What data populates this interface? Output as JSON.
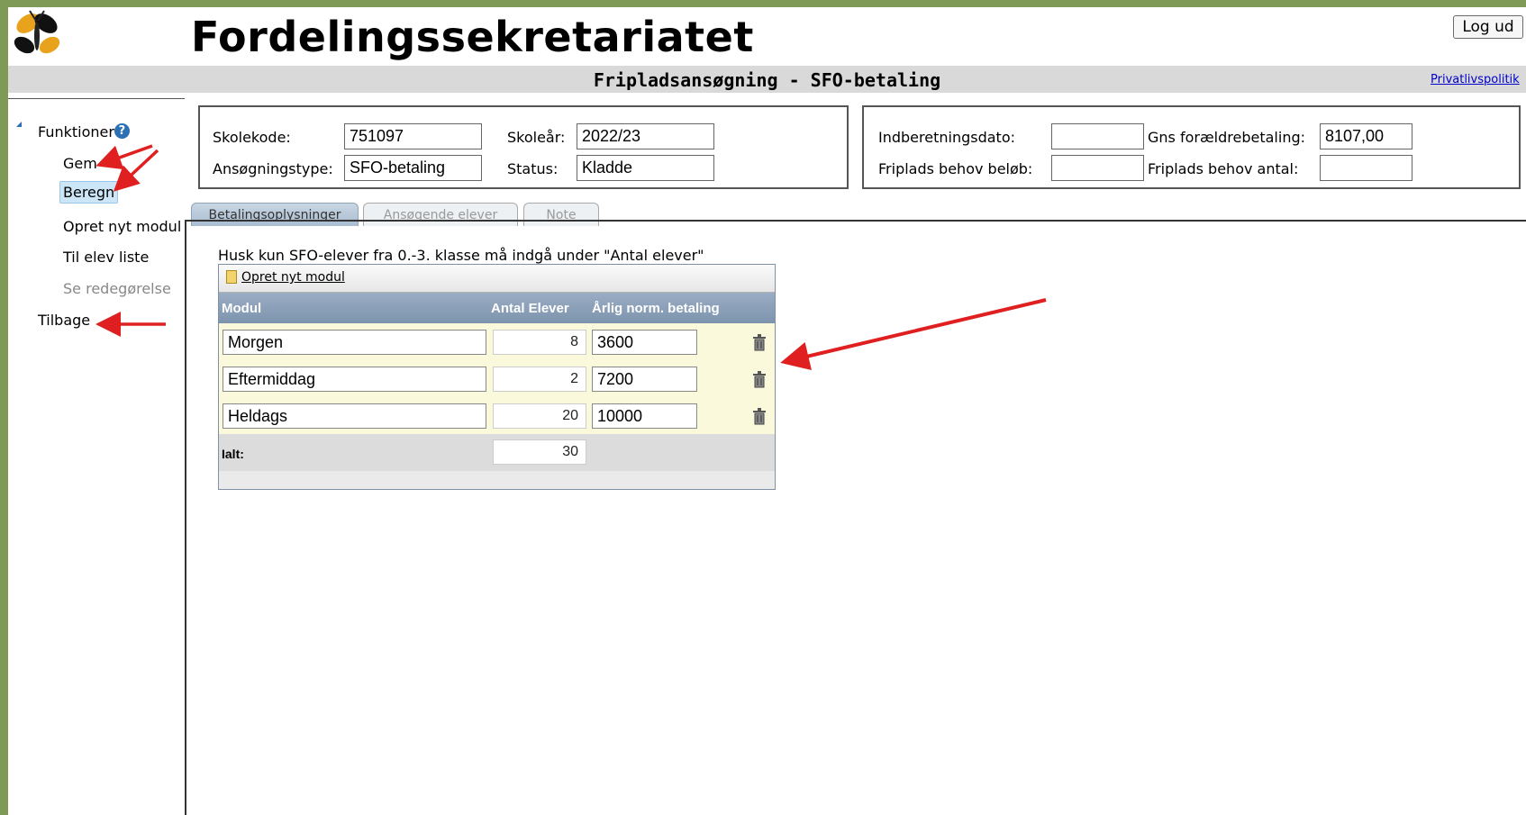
{
  "app": {
    "title": "Fordelingssekretariatet",
    "subtitle": "Fripladsansøgning - SFO-betaling",
    "logout_label": "Log ud",
    "privacy_link": "Privatlivspolitik"
  },
  "sidebar": {
    "group_label": "Funktioner",
    "help_glyph": "?",
    "items": [
      {
        "label": "Gem",
        "state": "normal"
      },
      {
        "label": "Beregn",
        "state": "selected"
      },
      {
        "label": "Opret nyt modul",
        "state": "normal"
      },
      {
        "label": "Til elev liste",
        "state": "normal"
      },
      {
        "label": "Se redegørelse",
        "state": "disabled"
      },
      {
        "label": "Tilbage",
        "state": "normal"
      }
    ]
  },
  "form_left": {
    "skolekode_label": "Skolekode:",
    "skolekode_value": "751097",
    "skoleaar_label": "Skoleår:",
    "skoleaar_value": "2022/23",
    "ansoegningstype_label": "Ansøgningstype:",
    "ansoegningstype_value": "SFO-betaling",
    "status_label": "Status:",
    "status_value": "Kladde"
  },
  "form_right": {
    "indberetningsdato_label": "Indberetningsdato:",
    "indberetningsdato_value": "",
    "gns_label": "Gns forældrebetaling:",
    "gns_value": "8107,00",
    "belob_label": "Friplads behov beløb:",
    "belob_value": "",
    "antal_label": "Friplads behov antal:",
    "antal_value": ""
  },
  "tabs": [
    {
      "label": "Betalingsoplysninger",
      "active": true
    },
    {
      "label": "Ansøgende elever",
      "active": false
    },
    {
      "label": "Note",
      "active": false
    }
  ],
  "notice": "Husk kun SFO-elever fra 0.-3. klasse må indgå under \"Antal elever\"",
  "grid": {
    "add_label": "Opret nyt modul",
    "columns": [
      "Modul",
      "Antal Elever",
      "Årlig norm. betaling"
    ],
    "rows": [
      {
        "modul": "Morgen",
        "antal": "8",
        "betaling": "3600"
      },
      {
        "modul": "Eftermiddag",
        "antal": "2",
        "betaling": "7200"
      },
      {
        "modul": "Heldags",
        "antal": "20",
        "betaling": "10000"
      }
    ],
    "total_label": "Ialt:",
    "total_value": "30"
  },
  "colors": {
    "accent": "#2b6fb5",
    "annotation": "#e02020",
    "grid_header": "#8aa0b9",
    "frame": "#7f9a56"
  }
}
